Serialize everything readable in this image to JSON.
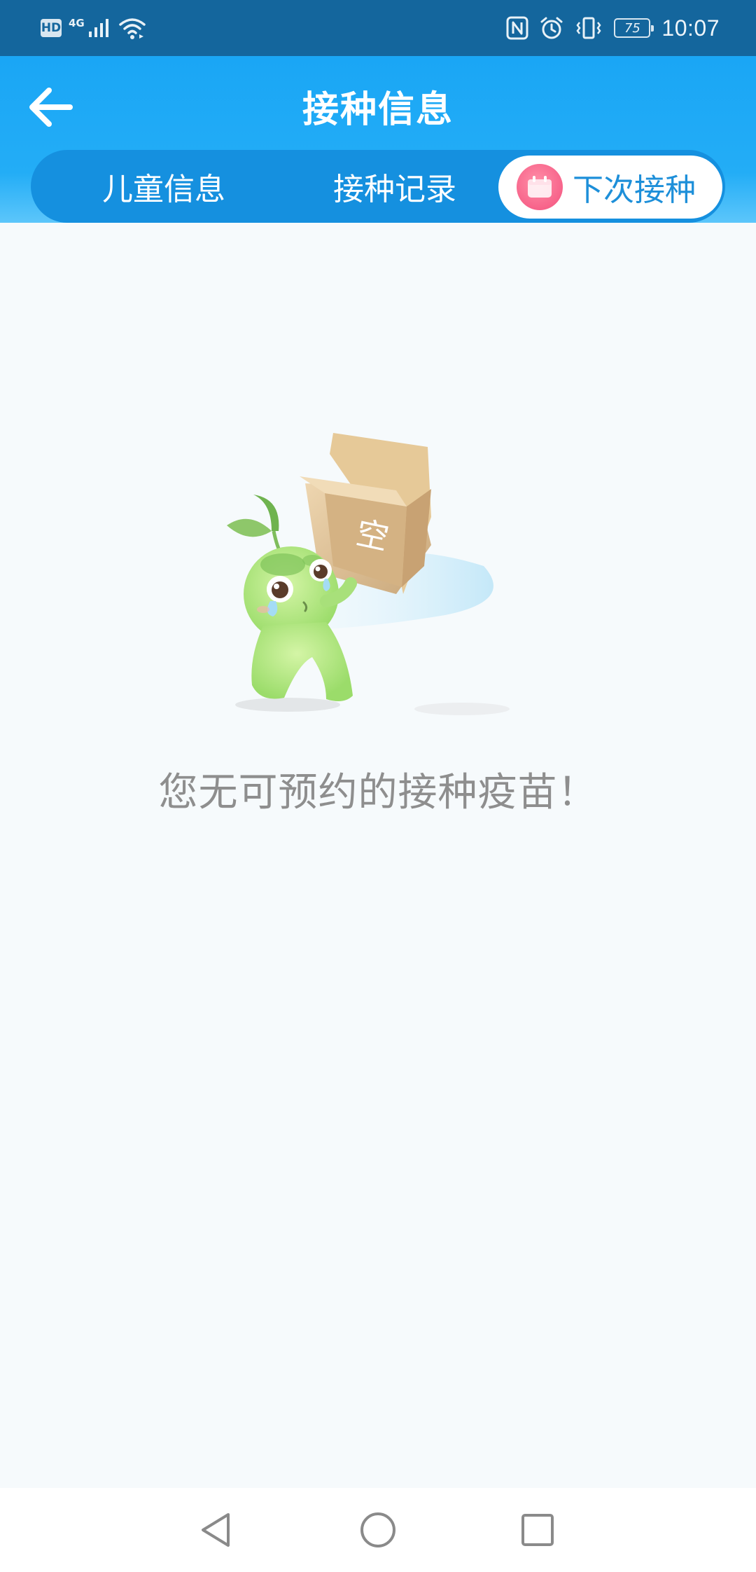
{
  "status_bar": {
    "hd_label": "HD",
    "network_label": "4G",
    "battery_level": "75",
    "time": "10:07"
  },
  "header": {
    "title": "接种信息",
    "back_icon": "arrow-left-icon"
  },
  "tabs": {
    "items": [
      {
        "label": "儿童信息",
        "active": false
      },
      {
        "label": "接种记录",
        "active": false
      },
      {
        "label": "下次接种",
        "active": true,
        "icon": "calendar-icon"
      }
    ]
  },
  "empty_state": {
    "illustration": "sprout-character-throwing-empty-box",
    "box_label": "空",
    "message": "您无可预约的接种疫苗！"
  },
  "colors": {
    "status_bar": "#14669d",
    "header": "#1aa6f5",
    "tab_bar": "#1590df",
    "active_tab_text": "#1d8fd9",
    "tab_icon": "#f7638a",
    "background": "#f6fafc",
    "message_text": "#8e8e8e"
  },
  "nav_bar": {
    "back_icon": "triangle-back-icon",
    "home_icon": "circle-home-icon",
    "recents_icon": "square-recents-icon"
  }
}
